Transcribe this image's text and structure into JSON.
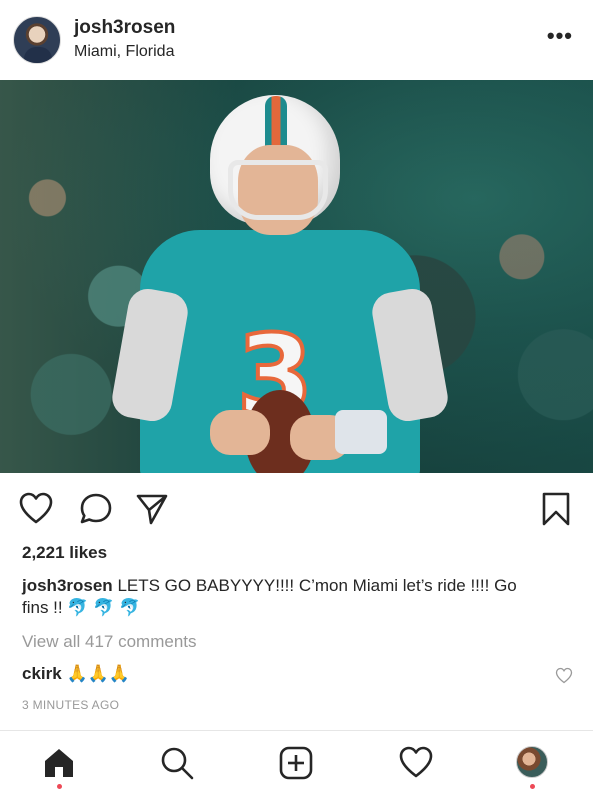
{
  "post": {
    "username": "josh3rosen",
    "location": "Miami, Florida",
    "more_icon": "•••",
    "photo_jersey_number": "3",
    "likes": "2,221 likes",
    "caption_user": "josh3rosen",
    "caption_text": "LETS GO BABYYYY!!!! C’mon Miami let’s ride !!!! Go fins !! 🐬 🐬 🐬",
    "view_all_comments": "View all 417 comments",
    "comment_user": "ckirk",
    "comment_text": "🙏🙏🙏",
    "timestamp": "3 MINUTES AGO"
  },
  "icons": {
    "like": "heart-icon",
    "comment": "comment-icon",
    "share": "share-icon",
    "save": "bookmark-icon",
    "home": "home-icon",
    "search": "search-icon",
    "new_post": "add-post-icon",
    "activity": "heart-icon",
    "profile": "profile-avatar"
  },
  "colors": {
    "text": "#262626",
    "muted": "#999999",
    "notification_dot": "#ed4956",
    "team_aqua": "#1fa3a8",
    "team_orange": "#e8683b"
  }
}
